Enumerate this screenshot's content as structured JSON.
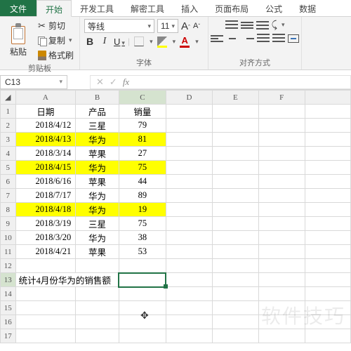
{
  "tabs": {
    "file": "文件",
    "home": "开始",
    "dev": "开发工具",
    "analyze": "解密工具",
    "insert": "插入",
    "layout": "页面布局",
    "formula": "公式",
    "data": "数据"
  },
  "ribbon": {
    "clipboard": {
      "paste": "粘贴",
      "cut": "剪切",
      "copy": "复制",
      "formatPainter": "格式刷",
      "group": "剪贴板"
    },
    "font": {
      "name": "等线",
      "size": "11",
      "bold": "B",
      "italic": "I",
      "underline": "U",
      "group": "字体",
      "fontColorGlyph": "A"
    },
    "align": {
      "merge": "合并",
      "group": "对齐方式"
    }
  },
  "nameBox": "C13",
  "fx": "fx",
  "columns": [
    "A",
    "B",
    "C",
    "D",
    "E",
    "F"
  ],
  "headers": {
    "date": "日期",
    "product": "产品",
    "sales": "销量"
  },
  "rows": [
    {
      "n": "2",
      "date": "2018/4/12",
      "product": "三星",
      "sales": "79",
      "hl": false
    },
    {
      "n": "3",
      "date": "2018/4/13",
      "product": "华为",
      "sales": "81",
      "hl": true
    },
    {
      "n": "4",
      "date": "2018/3/14",
      "product": "苹果",
      "sales": "27",
      "hl": false
    },
    {
      "n": "5",
      "date": "2018/4/15",
      "product": "华为",
      "sales": "75",
      "hl": true
    },
    {
      "n": "6",
      "date": "2018/6/16",
      "product": "苹果",
      "sales": "44",
      "hl": false
    },
    {
      "n": "7",
      "date": "2018/7/17",
      "product": "华为",
      "sales": "89",
      "hl": false
    },
    {
      "n": "8",
      "date": "2018/4/18",
      "product": "华为",
      "sales": "19",
      "hl": true
    },
    {
      "n": "9",
      "date": "2018/3/19",
      "product": "三星",
      "sales": "75",
      "hl": false
    },
    {
      "n": "10",
      "date": "2018/3/20",
      "product": "华为",
      "sales": "38",
      "hl": false
    },
    {
      "n": "11",
      "date": "2018/4/21",
      "product": "苹果",
      "sales": "53",
      "hl": false
    }
  ],
  "summaryRowNum": "13",
  "summaryLabel": "统计4月份华为的销售额",
  "emptyRowNums": [
    "12",
    "14",
    "15",
    "16",
    "17"
  ],
  "watermark": "软件技巧"
}
